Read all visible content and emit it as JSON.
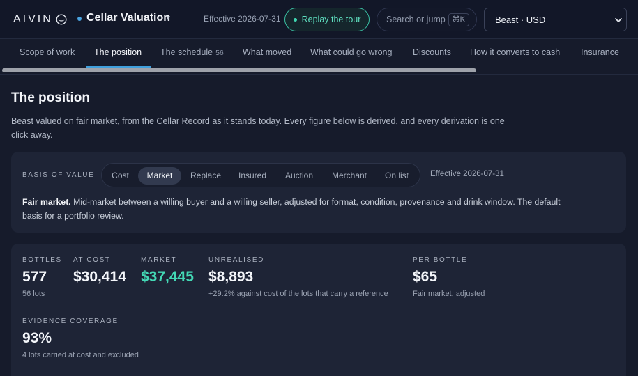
{
  "brand": {
    "wordmark": "AIVIN",
    "logo_icon": "wine-glass-icon"
  },
  "app": {
    "title": "Cellar Valuation",
    "status_color": "#4aa3e0"
  },
  "header": {
    "effective": "Effective 2026-07-31",
    "tour_button": "Replay the tour",
    "search_placeholder": "Search or jump",
    "search_shortcut": "⌘K",
    "currency_select": "Beast · USD"
  },
  "tabs": [
    {
      "label": "Scope of work"
    },
    {
      "label": "The position",
      "active": true
    },
    {
      "label": "The schedule",
      "count": "56"
    },
    {
      "label": "What moved"
    },
    {
      "label": "What could go wrong"
    },
    {
      "label": "Discounts"
    },
    {
      "label": "How it converts to cash"
    },
    {
      "label": "Insurance"
    }
  ],
  "page": {
    "title": "The position",
    "intro": "Beast valued on fair market, from the Cellar Record as it stands today. Every figure below is derived, and every derivation is one click away."
  },
  "basis": {
    "label": "BASIS OF VALUE",
    "options": [
      "Cost",
      "Market",
      "Replace",
      "Insured",
      "Auction",
      "Merchant",
      "On list"
    ],
    "selected": "Market",
    "effective": "Effective 2026-07-31",
    "desc_title": "Fair market.",
    "desc_body": " Mid-market between a willing buyer and a willing seller, adjusted for format, condition, provenance and drink window. The default basis for a portfolio review."
  },
  "stats": {
    "bottles": {
      "label": "BOTTLES",
      "value": "577",
      "sub": "56 lots"
    },
    "at_cost": {
      "label": "AT COST",
      "value": "$30,414"
    },
    "market": {
      "label": "MARKET",
      "value": "$37,445"
    },
    "unrealised": {
      "label": "UNREALISED",
      "value": "$8,893",
      "sub": "+29.2% against cost of the lots that carry a reference"
    },
    "per_bottle": {
      "label": "PER BOTTLE",
      "value": "$65",
      "sub": "Fair market, adjusted"
    },
    "coverage": {
      "label": "EVIDENCE COVERAGE",
      "value": "93%",
      "sub": "4 lots carried at cost and excluded"
    }
  },
  "colors": {
    "accent": "#3f9fdc",
    "teal": "#43d8b5",
    "background": "#161b2b",
    "panel": "#1e2436"
  }
}
